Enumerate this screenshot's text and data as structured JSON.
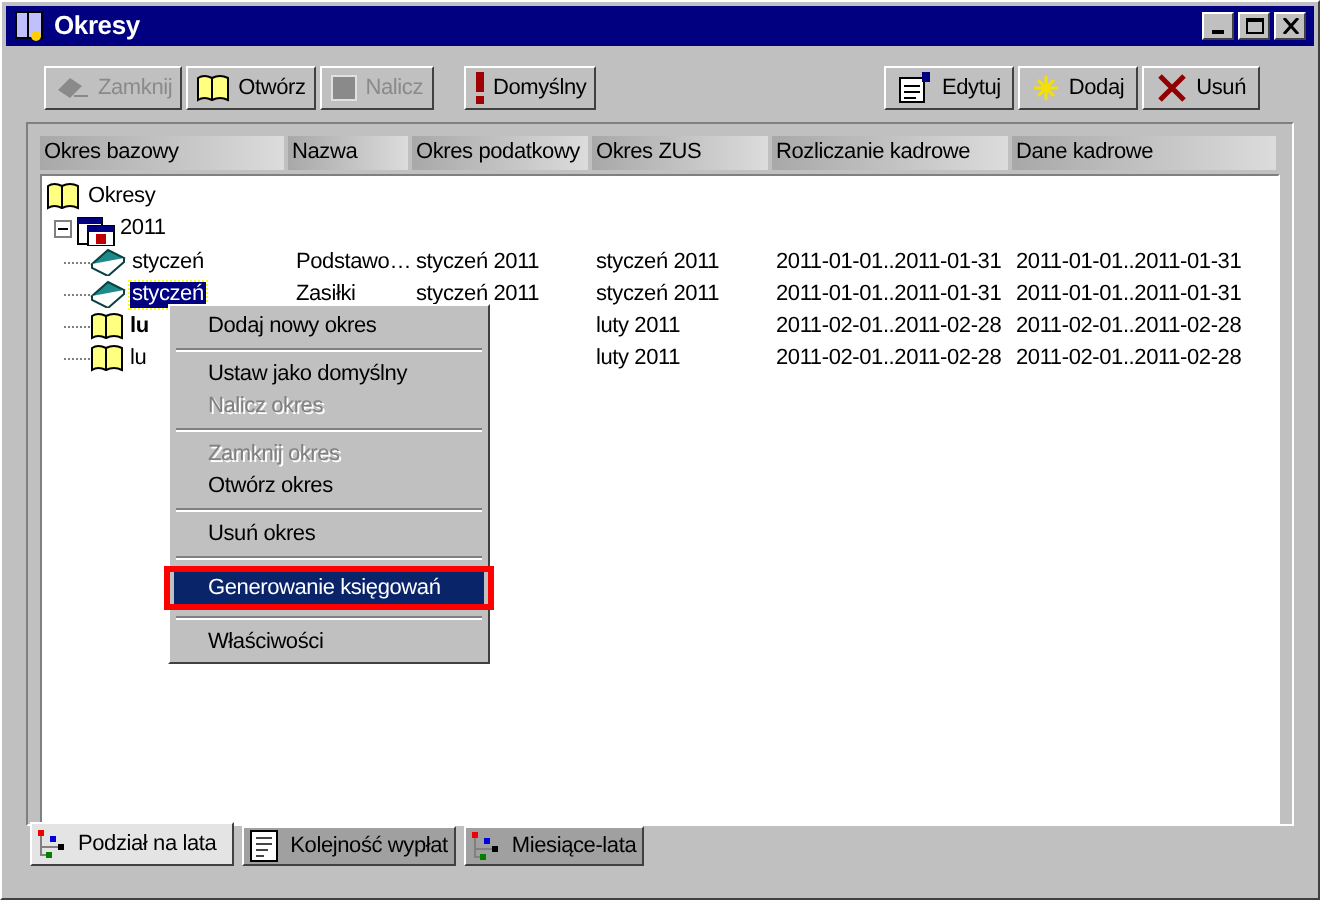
{
  "window": {
    "title": "Okresy"
  },
  "toolbar_left": [
    {
      "label": "Zamknij",
      "kind": "eraser",
      "disabled": true
    },
    {
      "label": "Otwórz",
      "kind": "book",
      "disabled": false
    },
    {
      "label": "Nalicz",
      "kind": "square",
      "disabled": true
    },
    {
      "label": "Domyślny",
      "kind": "exclamation",
      "disabled": false
    }
  ],
  "toolbar_right": [
    {
      "label": "Edytuj",
      "kind": "edit",
      "disabled": false
    },
    {
      "label": "Dodaj",
      "kind": "star",
      "disabled": false
    },
    {
      "label": "Usuń",
      "kind": "cross",
      "disabled": false
    }
  ],
  "columns": [
    "Okres bazowy",
    "Nazwa",
    "Okres podatkowy",
    "Okres ZUS",
    "Rozliczanie kadrowe",
    "Dane kadrowe"
  ],
  "tree": {
    "label": "Okresy",
    "children": [
      {
        "label": "2011",
        "expanded": true,
        "children": [
          {
            "label": "styczeń",
            "kind": "closed",
            "bold": false,
            "selected": false,
            "nazwa": "Podstawo…",
            "okres_podatkowy": "styczeń 2011",
            "okres_zus": "styczeń 2011",
            "rozliczanie_kadrowe": "2011-01-01..2011-01-31",
            "dane_kadrowe": "2011-01-01..2011-01-31"
          },
          {
            "label": "styczeń",
            "kind": "closed",
            "bold": false,
            "selected": true,
            "nazwa": "Zasiłki",
            "okres_podatkowy": "styczeń 2011",
            "okres_zus": "styczeń 2011",
            "rozliczanie_kadrowe": "2011-01-01..2011-01-31",
            "dane_kadrowe": "2011-01-01..2011-01-31"
          },
          {
            "label": "lu",
            "kind": "open",
            "bold": true,
            "selected": false,
            "okres_zus": "luty 2011",
            "rozliczanie_kadrowe": "2011-02-01..2011-02-28",
            "dane_kadrowe": "2011-02-01..2011-02-28"
          },
          {
            "label": "lu",
            "kind": "open",
            "bold": false,
            "selected": false,
            "okres_zus": "luty 2011",
            "rozliczanie_kadrowe": "2011-02-01..2011-02-28",
            "dane_kadrowe": "2011-02-01..2011-02-28"
          }
        ]
      }
    ]
  },
  "context_menu": [
    {
      "kind": "item",
      "label": "Dodaj nowy okres",
      "disabled": false,
      "selected": false
    },
    {
      "kind": "separator"
    },
    {
      "kind": "item",
      "label": "Ustaw jako domyślny",
      "disabled": false,
      "selected": false
    },
    {
      "kind": "item",
      "label": "Nalicz okres",
      "disabled": true,
      "selected": false
    },
    {
      "kind": "separator"
    },
    {
      "kind": "item",
      "label": "Zamknij okres",
      "disabled": true,
      "selected": false
    },
    {
      "kind": "item",
      "label": "Otwórz okres",
      "disabled": false,
      "selected": false
    },
    {
      "kind": "separator"
    },
    {
      "kind": "item",
      "label": "Usuń okres",
      "disabled": false,
      "selected": false
    },
    {
      "kind": "separator"
    },
    {
      "kind": "item",
      "label": "Generowanie księgowań",
      "disabled": false,
      "selected": true
    },
    {
      "kind": "separator"
    },
    {
      "kind": "item",
      "label": "Właściwości",
      "disabled": false,
      "selected": false
    }
  ],
  "tabs": [
    {
      "label": "Podział na lata",
      "kind": "tree",
      "selected": true
    },
    {
      "label": "Kolejność wypłat",
      "kind": "list",
      "selected": false
    },
    {
      "label": "Miesiące-lata",
      "kind": "tree",
      "selected": false
    }
  ]
}
